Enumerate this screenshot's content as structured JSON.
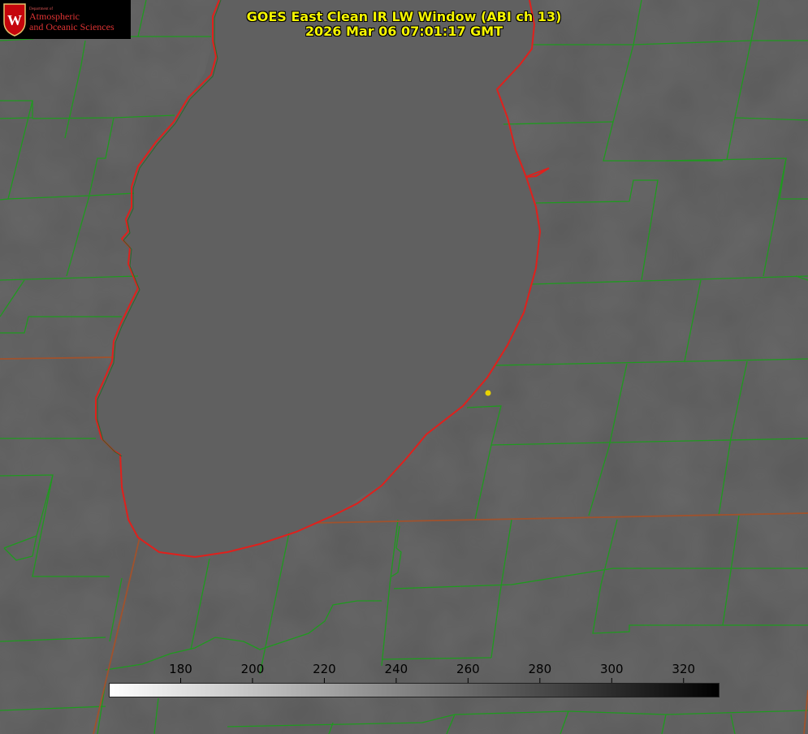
{
  "title": {
    "line1": "GOES East Clean IR LW Window (ABI ch 13)",
    "line2": "2026 Mar 06 07:01:17 GMT"
  },
  "logo": {
    "dept": "Department of",
    "line1": "Atmospheric",
    "line2": "and Oceanic Sciences",
    "icon": "uw-seal-icon"
  },
  "colorbar": {
    "min": 160,
    "max": 330,
    "ticks": [
      "180",
      "200",
      "220",
      "240",
      "260",
      "280",
      "300",
      "320"
    ]
  },
  "colors": {
    "background": "#5a5a5a",
    "lake": "#5f5f5f",
    "county_lines": "#1f9a1f",
    "coastline": "#e0201c",
    "title_text": "#f5f500",
    "marker": "#e8d200"
  }
}
